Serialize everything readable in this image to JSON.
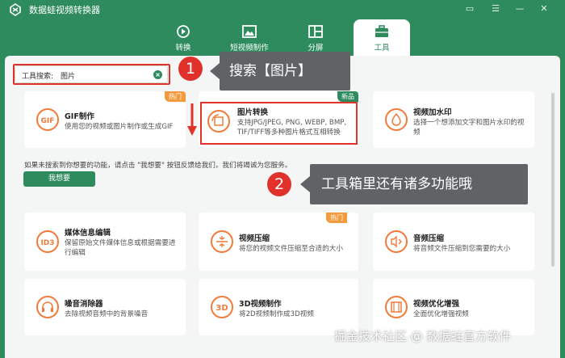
{
  "app": {
    "title": "数据蛙视频转换器"
  },
  "window_controls": [
    {
      "name": "feedback-icon",
      "glyph": "▭"
    },
    {
      "name": "menu-icon",
      "glyph": "☰"
    },
    {
      "name": "minimize-icon",
      "glyph": "—"
    },
    {
      "name": "close-icon",
      "glyph": "✕"
    }
  ],
  "nav": {
    "tabs": [
      {
        "label": "转换",
        "active": false
      },
      {
        "label": "短视频制作",
        "active": false
      },
      {
        "label": "分屏",
        "active": false
      },
      {
        "label": "工具",
        "active": true
      }
    ]
  },
  "search": {
    "label": "工具搜索:",
    "value": "图片"
  },
  "search_results": [
    {
      "title": "GIF制作",
      "desc": "使用您的视频或图片制作或生成GIF",
      "badge": "热门",
      "icon_text": "GIF"
    },
    {
      "title": "图片转换",
      "desc": "支持JPG/JPEG, PNG, WEBP, BMP, TIF/TIFF等多种图片格式互相转换",
      "badge": "新品"
    },
    {
      "title": "视频加水印",
      "desc": "选择一个想添加文字和图片水印的视频"
    }
  ],
  "hint": {
    "text": "如果未搜索到你想要的功能，请点击 \"我想要\" 按钮反馈给我们，我们将竭诚为您服务。",
    "button": "我想要"
  },
  "tools": [
    {
      "title": "媒体信息编辑",
      "desc": "保留原始文件媒体信息或根据需要进行编辑",
      "icon_text": "ID3"
    },
    {
      "title": "视频压缩",
      "desc": "将您的视频文件压缩至合适的大小",
      "badge": "热门"
    },
    {
      "title": "音频压缩",
      "desc": "将音频文件压缩到您需要的大小"
    },
    {
      "title": "噪音消除器",
      "desc": "去除视频音频中的背景噪音"
    },
    {
      "title": "3D视频制作",
      "desc": "将2D视频制作成3D视频",
      "icon_text": "3D"
    },
    {
      "title": "视频优化增强",
      "desc": "全面优化增强视频"
    }
  ],
  "annotations": [
    {
      "number": "1",
      "text": "搜索【图片】"
    },
    {
      "number": "2",
      "text": "工具箱里还有诸多功能哦"
    }
  ],
  "watermark": "掘金技术社区 @ 数据蛙官方软件",
  "colors": {
    "brand": "#2e8b5e",
    "highlight": "#e0322a",
    "hot": "#f39a3c",
    "callout": "#5f6366"
  }
}
